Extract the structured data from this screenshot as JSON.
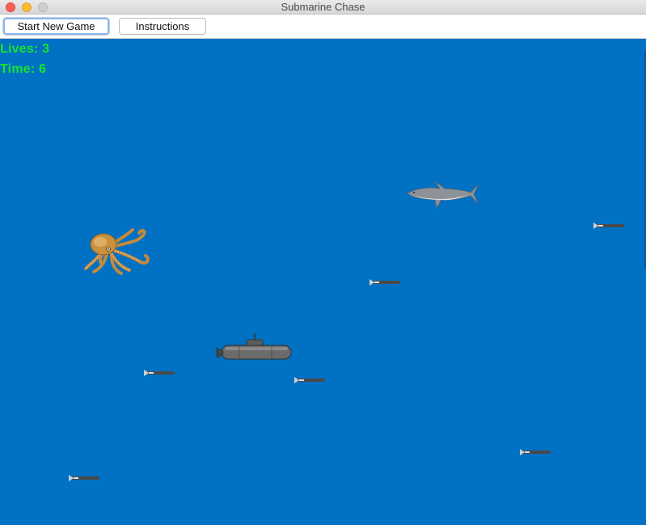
{
  "window": {
    "title": "Submarine Chase"
  },
  "toolbar": {
    "start_label": "Start New Game",
    "instructions_label": "Instructions"
  },
  "hud": {
    "lives_label": "Lives: ",
    "lives_value": "3",
    "time_label": "Time: ",
    "time_value": "6"
  },
  "colors": {
    "water": "#0071c3",
    "hud_text": "#18e32f"
  },
  "sprites": [
    "shark",
    "octopus",
    "submarine",
    "torpedo",
    "torpedo",
    "torpedo",
    "torpedo",
    "torpedo",
    "torpedo"
  ]
}
